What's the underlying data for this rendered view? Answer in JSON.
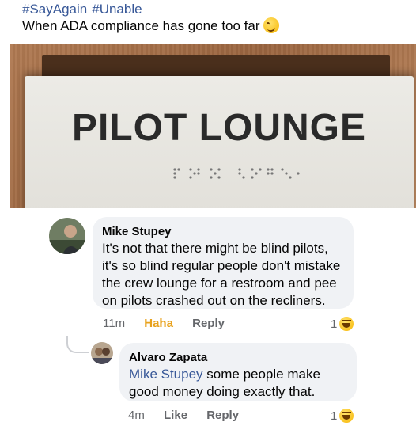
{
  "post": {
    "hashtags": [
      "#SayAgain",
      "#Unable"
    ],
    "text": "When ADA compliance has gone too far",
    "emoji": "woozy-face-emoji"
  },
  "photo": {
    "sign_text": "PILOT LOUNGE"
  },
  "comments": [
    {
      "author": "Mike Stupey",
      "lines": [
        "It's not that there might be blind pilots,",
        "it's so blind regular people don't mistake",
        "the crew lounge for a restroom and pee",
        "on pilots crashed out on the recliners."
      ],
      "time": "11m",
      "reaction_action": "Haha",
      "reply": "Reply",
      "reaction_count": "1"
    },
    {
      "author": "Alvaro Zapata",
      "mention": "Mike Stupey",
      "line1_rest": " some people make",
      "line2": "good money doing exactly that.",
      "time": "4m",
      "like": "Like",
      "reply": "Reply",
      "reaction_count": "1"
    }
  ],
  "colors": {
    "link": "#385898",
    "bubble": "#f0f2f5",
    "meta": "#65676b",
    "haha": "#e8a21d"
  }
}
